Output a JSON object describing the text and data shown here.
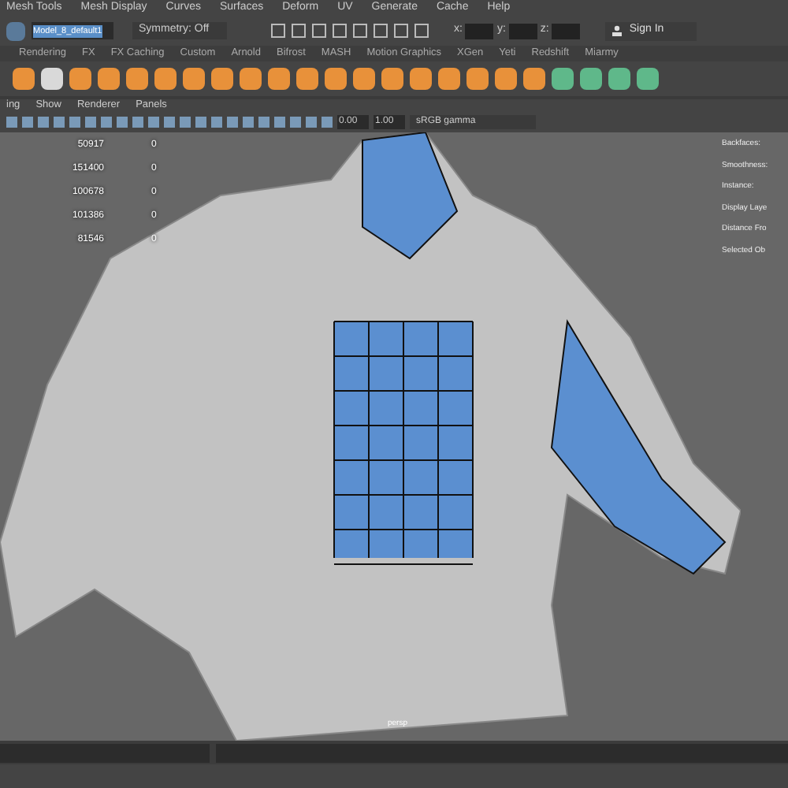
{
  "menu_bar": [
    "Mesh Tools",
    "Mesh Display",
    "Curves",
    "Surfaces",
    "Deform",
    "UV",
    "Generate",
    "Cache",
    "Help"
  ],
  "status_line": {
    "object_field": "Model_8_default1",
    "symmetry": "Symmetry: Off",
    "x_label": "x:",
    "y_label": "y:",
    "z_label": "z:",
    "sign_in": "Sign In"
  },
  "shelf_tabs": [
    {
      "label": "Rendering",
      "selected": false
    },
    {
      "label": "FX",
      "selected": false
    },
    {
      "label": "FX Caching",
      "selected": false
    },
    {
      "label": "Custom",
      "selected": false
    },
    {
      "label": "Arnold",
      "selected": false
    },
    {
      "label": "Bifrost",
      "selected": false
    },
    {
      "label": "MASH",
      "selected": false
    },
    {
      "label": "Motion Graphics",
      "selected": false
    },
    {
      "label": "XGen",
      "selected": false
    },
    {
      "label": "Yeti",
      "selected": false
    },
    {
      "label": "Redshift",
      "selected": false
    },
    {
      "label": "Miarmy",
      "selected": false
    }
  ],
  "panel_menu": [
    "ing",
    "Show",
    "Renderer",
    "Panels"
  ],
  "panel_toolbar": {
    "exposure": "0.00",
    "gamma": "1.00",
    "color_space": "sRGB gamma"
  },
  "hud_left": [
    {
      "value": "50917",
      "count": "0"
    },
    {
      "value": "151400",
      "count": "0"
    },
    {
      "value": "100678",
      "count": "0"
    },
    {
      "value": "101386",
      "count": "0"
    },
    {
      "value": "81546",
      "count": "0"
    }
  ],
  "hud_right": [
    "Backfaces:",
    "Smoothness:",
    "Instance:",
    "Display Laye",
    "Distance Fro",
    "Selected Ob"
  ],
  "camera_label": "persp"
}
